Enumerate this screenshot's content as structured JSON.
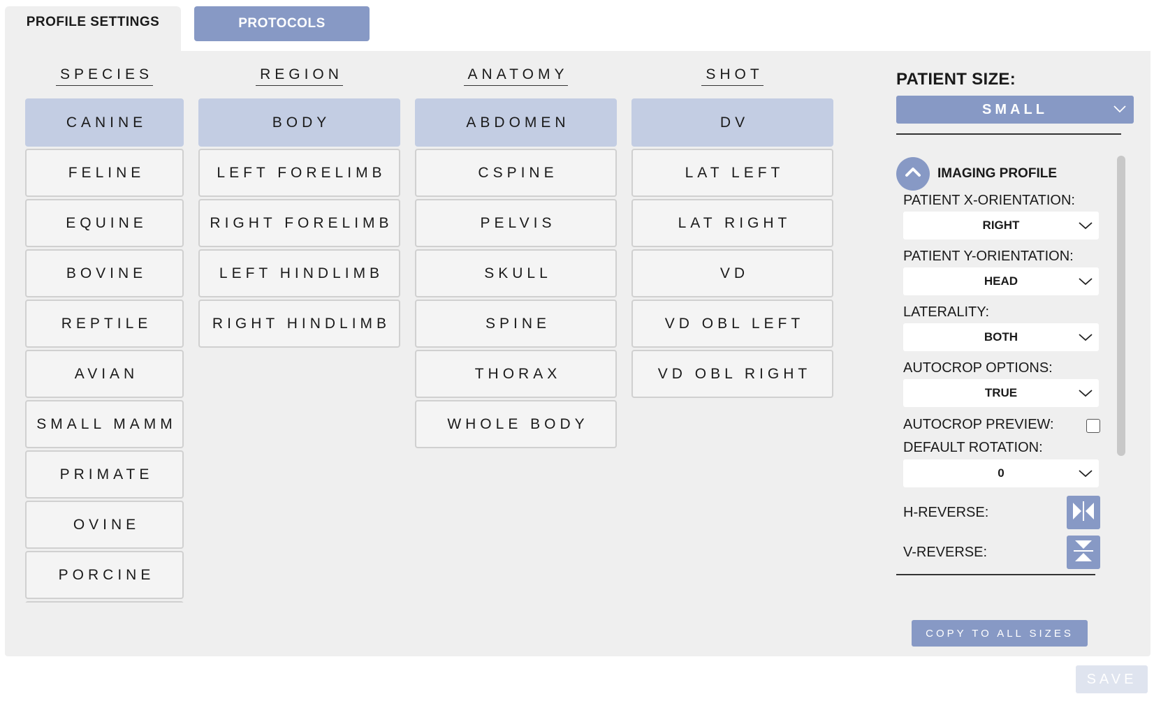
{
  "tabs": {
    "profile_settings": "PROFILE SETTINGS",
    "protocols": "PROTOCOLS"
  },
  "columns": {
    "species": {
      "header": "SPECIES",
      "items": [
        "CANINE",
        "FELINE",
        "EQUINE",
        "BOVINE",
        "REPTILE",
        "AVIAN",
        "SMALL MAMM",
        "PRIMATE",
        "OVINE",
        "PORCINE",
        ""
      ],
      "selected": "CANINE"
    },
    "region": {
      "header": "REGION",
      "items": [
        "BODY",
        "LEFT FORELIMB",
        "RIGHT FORELIMB",
        "LEFT HINDLIMB",
        "RIGHT HINDLIMB"
      ],
      "selected": "BODY"
    },
    "anatomy": {
      "header": "ANATOMY",
      "items": [
        "ABDOMEN",
        "CSPINE",
        "PELVIS",
        "SKULL",
        "SPINE",
        "THORAX",
        "WHOLE BODY"
      ],
      "selected": "ABDOMEN"
    },
    "shot": {
      "header": "SHOT",
      "items": [
        "DV",
        "LAT LEFT",
        "LAT RIGHT",
        "VD",
        "VD OBL LEFT",
        "VD OBL RIGHT"
      ],
      "selected": "DV"
    }
  },
  "patient_size": {
    "title": "PATIENT SIZE:",
    "value": "SMALL"
  },
  "imaging_profile": {
    "title": "IMAGING PROFILE",
    "x_orientation_label": "PATIENT X-ORIENTATION:",
    "x_orientation_value": "RIGHT",
    "y_orientation_label": "PATIENT Y-ORIENTATION:",
    "y_orientation_value": "HEAD",
    "laterality_label": "LATERALITY:",
    "laterality_value": "BOTH",
    "autocrop_options_label": "AUTOCROP OPTIONS:",
    "autocrop_options_value": "TRUE",
    "autocrop_preview_label": "AUTOCROP PREVIEW:",
    "autocrop_preview_checked": false,
    "default_rotation_label": "DEFAULT ROTATION:",
    "default_rotation_value": "0",
    "h_reverse_label": "H-REVERSE:",
    "v_reverse_label": "V-REVERSE:"
  },
  "copy_button": "COPY TO ALL SIZES",
  "save_button": "SAVE",
  "icons": {
    "collapse": "chevron-up-icon",
    "dropdown": "chevron-down-icon",
    "h_reverse": "flip-horizontal-icon",
    "v_reverse": "flip-vertical-icon"
  },
  "colors": {
    "accent": "#8799c5",
    "selected": "#c3cde3",
    "panel": "#efefef",
    "save_disabled": "#dfe4ef"
  }
}
